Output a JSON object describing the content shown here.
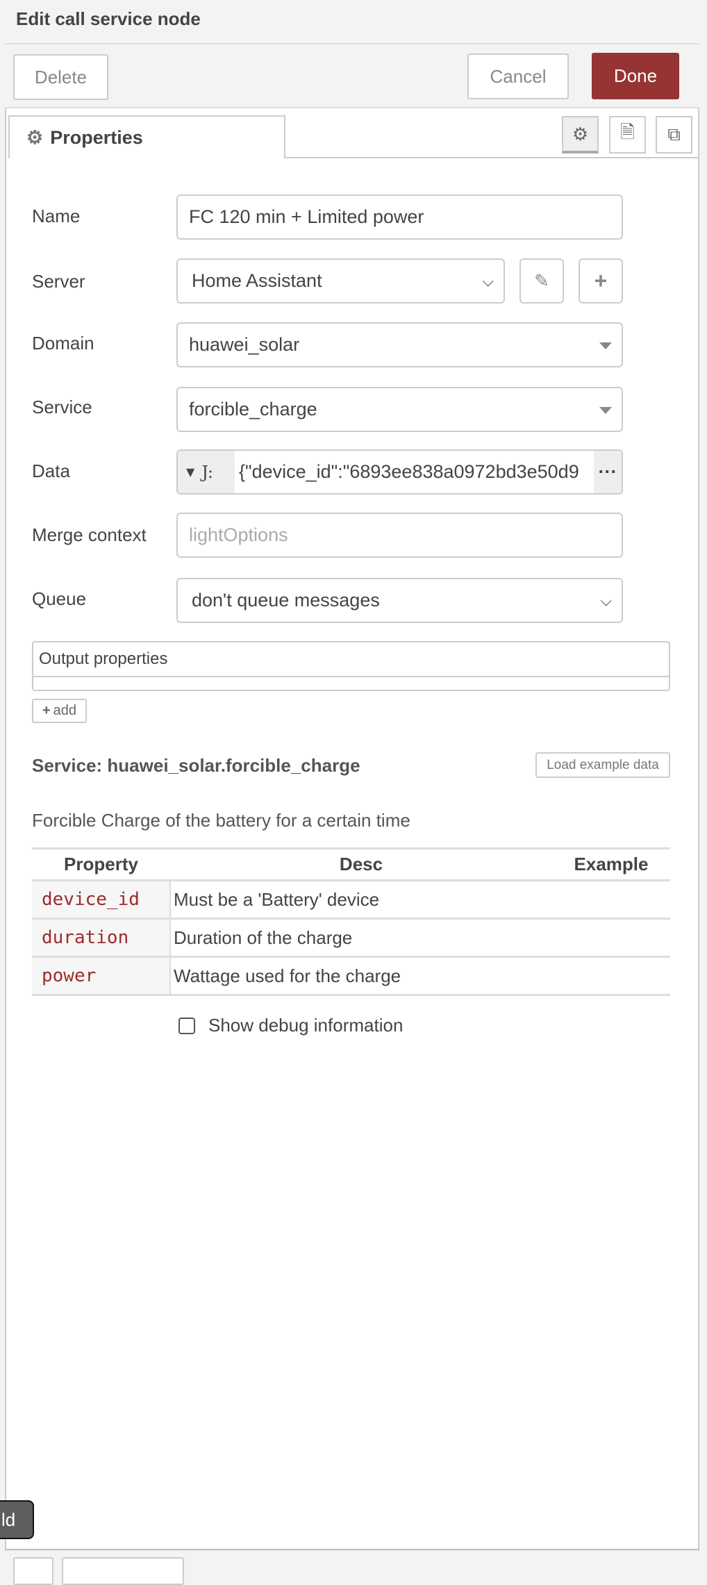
{
  "header": {
    "title": "Edit call service node"
  },
  "toolbar": {
    "delete": "Delete",
    "cancel": "Cancel",
    "done": "Done",
    "done_color": "#963434"
  },
  "tabs": {
    "properties": "Properties"
  },
  "form": {
    "name_label": "Name",
    "name_value": "FC 120 min + Limited power",
    "server_label": "Server",
    "server_value": "Home Assistant",
    "domain_label": "Domain",
    "domain_value": "huawei_solar",
    "service_label": "Service",
    "service_value": "forcible_charge",
    "data_label": "Data",
    "data_type": "J:",
    "data_value": "{\"device_id\":\"6893ee838a0972bd3e50d9",
    "merge_label": "Merge context",
    "merge_placeholder": "lightOptions",
    "queue_label": "Queue",
    "queue_value": "don't queue messages",
    "output_properties": "Output properties",
    "add": "add"
  },
  "service": {
    "heading": "Service: huawei_solar.forcible_charge",
    "load_example": "Load example data",
    "description": "Forcible Charge of the battery for a certain time",
    "columns": [
      "Property",
      "Desc",
      "Example"
    ],
    "rows": [
      {
        "property": "device_id",
        "desc": "Must be a 'Battery' device",
        "example": ""
      },
      {
        "property": "duration",
        "desc": "Duration of the charge",
        "example": ""
      },
      {
        "property": "power",
        "desc": "Wattage used for the charge",
        "example": ""
      }
    ]
  },
  "debug": {
    "label": "Show debug information",
    "checked": false
  },
  "tooltip": {
    "text": "ld"
  }
}
